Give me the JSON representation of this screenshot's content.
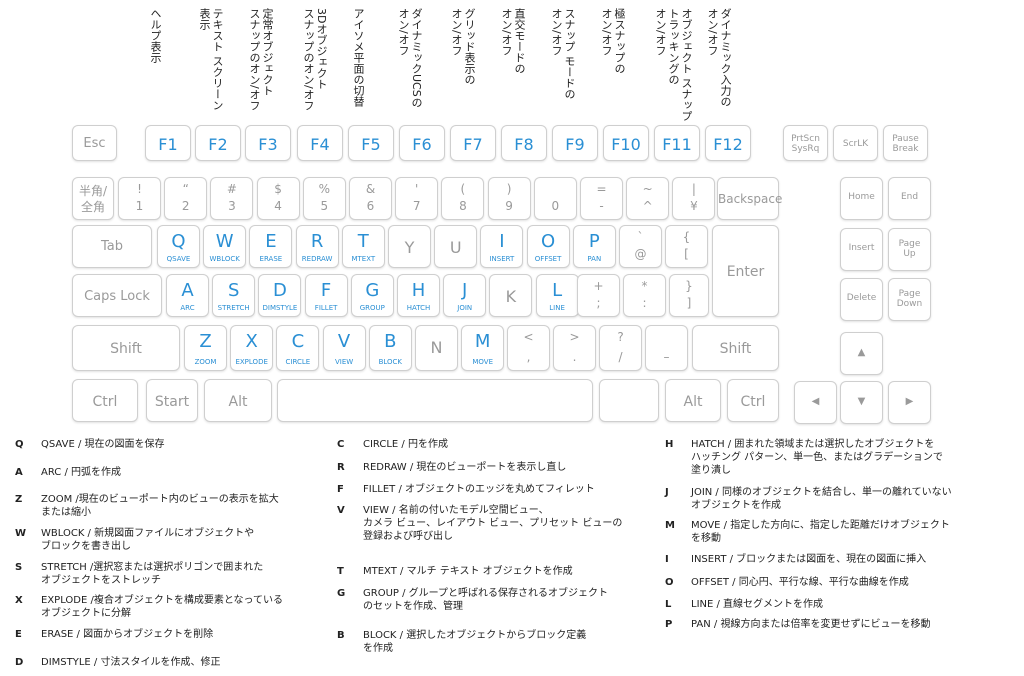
{
  "fkey_labels": {
    "f1": [
      "ヘルプ表示"
    ],
    "f2": [
      "テキスト スクリーン",
      "表示"
    ],
    "f3": [
      "定常オブジェクト",
      "スナップのオン/オフ"
    ],
    "f4": [
      "3Dオブジェクト",
      "スナップのオン/オフ"
    ],
    "f5": [
      "アイソメ平面の切替"
    ],
    "f6": [
      "ダイナミックUCSの",
      "オン/オフ"
    ],
    "f7": [
      "グリッド表示の",
      "オン/オフ"
    ],
    "f8": [
      "直交モードの",
      "オン/オフ"
    ],
    "f9": [
      "スナップ モードの",
      "オン/オフ"
    ],
    "f10": [
      "極スナップの",
      "オン/オフ"
    ],
    "f11": [
      "オブジェクト スナップ",
      "トラッキングの",
      "オン/オフ"
    ],
    "f12": [
      "ダイナミック入力の",
      "オン/オフ"
    ]
  },
  "keys": {
    "esc": "Esc",
    "f1": "F1",
    "f2": "F2",
    "f3": "F3",
    "f4": "F4",
    "f5": "F5",
    "f6": "F6",
    "f7": "F7",
    "f8": "F8",
    "f9": "F9",
    "f10": "F10",
    "f11": "F11",
    "f12": "F12",
    "prtscn": [
      "PrtScn",
      "SysRq"
    ],
    "scrlk": "ScrLK",
    "pause": [
      "Pause",
      "Break"
    ],
    "hankaku": [
      "半角/",
      "全角"
    ],
    "num_row": [
      {
        "top": "!",
        "bottom": "1"
      },
      {
        "top": "“",
        "bottom": "2"
      },
      {
        "top": "#",
        "bottom": "3"
      },
      {
        "top": "$",
        "bottom": "4"
      },
      {
        "top": "%",
        "bottom": "5"
      },
      {
        "top": "&",
        "bottom": "6"
      },
      {
        "top": "'",
        "bottom": "7"
      },
      {
        "top": "(",
        "bottom": "8"
      },
      {
        "top": ")",
        "bottom": "9"
      },
      {
        "top": "",
        "bottom": "0"
      },
      {
        "top": "=",
        "bottom": "-"
      },
      {
        "top": "~",
        "bottom": "^"
      },
      {
        "top": "|",
        "bottom": "¥"
      }
    ],
    "backspace": "Backspace",
    "tab": "Tab",
    "qrow": [
      {
        "l": "Q",
        "c": "QSAVE"
      },
      {
        "l": "W",
        "c": "WBLOCK"
      },
      {
        "l": "E",
        "c": "ERASE"
      },
      {
        "l": "R",
        "c": "REDRAW"
      },
      {
        "l": "T",
        "c": "MTEXT"
      },
      {
        "l": "Y",
        "c": ""
      },
      {
        "l": "U",
        "c": ""
      },
      {
        "l": "I",
        "c": "INSERT"
      },
      {
        "l": "O",
        "c": "OFFSET"
      },
      {
        "l": "P",
        "c": "PAN"
      }
    ],
    "at": {
      "top": "`",
      "bottom": "@"
    },
    "lbracket": {
      "top": "{",
      "bottom": "["
    },
    "enter": "Enter",
    "capslock": "Caps Lock",
    "arow": [
      {
        "l": "A",
        "c": "ARC"
      },
      {
        "l": "S",
        "c": "STRETCH"
      },
      {
        "l": "D",
        "c": "DIMSTYLE"
      },
      {
        "l": "F",
        "c": "FILLET"
      },
      {
        "l": "G",
        "c": "GROUP"
      },
      {
        "l": "H",
        "c": "HATCH"
      },
      {
        "l": "J",
        "c": "JOIN"
      },
      {
        "l": "K",
        "c": ""
      },
      {
        "l": "L",
        "c": "LINE"
      }
    ],
    "semicolon": {
      "top": "+",
      "bottom": ";"
    },
    "colon": {
      "top": "*",
      "bottom": ":"
    },
    "rbracket": {
      "top": "}",
      "bottom": "]"
    },
    "shift": "Shift",
    "zrow": [
      {
        "l": "Z",
        "c": "ZOOM"
      },
      {
        "l": "X",
        "c": "EXPLODE"
      },
      {
        "l": "C",
        "c": "CIRCLE"
      },
      {
        "l": "V",
        "c": "VIEW"
      },
      {
        "l": "B",
        "c": "BLOCK"
      },
      {
        "l": "N",
        "c": ""
      },
      {
        "l": "M",
        "c": "MOVE"
      }
    ],
    "comma": {
      "top": "<",
      "bottom": ","
    },
    "period": {
      "top": ">",
      "bottom": "."
    },
    "slash": {
      "top": "?",
      "bottom": "/"
    },
    "underscore": {
      "top": "",
      "bottom": "–"
    },
    "ctrl": "Ctrl",
    "start": "Start",
    "alt": "Alt",
    "home": "Home",
    "end": "End",
    "insert": "Insert",
    "pageup": [
      "Page",
      "Up"
    ],
    "delete": "Delete",
    "pagedown": [
      "Page",
      "Down"
    ],
    "up": "▲",
    "left": "◀",
    "down": "▼",
    "right": "▶"
  },
  "descriptions": {
    "col1": [
      {
        "letter": "Q",
        "lines": [
          "QSAVE / 現在の図面を保存"
        ]
      },
      {
        "letter": "A",
        "lines": [
          "ARC / 円弧を作成"
        ]
      },
      {
        "letter": "Z",
        "lines": [
          "ZOOM /現在のビューポート内のビューの表示を拡大",
          "または縮小"
        ]
      },
      {
        "letter": "W",
        "lines": [
          "WBLOCK / 新規図面ファイルにオブジェクトや",
          "ブロックを書き出し"
        ]
      },
      {
        "letter": "S",
        "lines": [
          "STRETCH /選択窓または選択ポリゴンで囲まれた",
          "オブジェクトをストレッチ"
        ]
      },
      {
        "letter": "X",
        "lines": [
          "EXPLODE /複合オブジェクトを構成要素となっている",
          "オブジェクトに分解"
        ]
      },
      {
        "letter": "E",
        "lines": [
          "ERASE / 図面からオブジェクトを削除"
        ]
      },
      {
        "letter": "D",
        "lines": [
          "DIMSTYLE / 寸法スタイルを作成、修正"
        ]
      }
    ],
    "col2": [
      {
        "letter": "C",
        "lines": [
          "CIRCLE / 円を作成"
        ]
      },
      {
        "letter": "R",
        "lines": [
          "REDRAW / 現在のビューポートを表示し直し"
        ]
      },
      {
        "letter": "F",
        "lines": [
          "FILLET / オブジェクトのエッジを丸めてフィレット"
        ]
      },
      {
        "letter": "V",
        "lines": [
          "VIEW / 名前の付いたモデル空間ビュー、",
          "カメラ ビュー、レイアウト ビュー、プリセット ビューの",
          "登録および呼び出し"
        ]
      },
      {
        "letter": "T",
        "lines": [
          "MTEXT / マルチ テキスト オブジェクトを作成"
        ]
      },
      {
        "letter": "G",
        "lines": [
          "GROUP / グループと呼ばれる保存されるオブジェクト",
          "のセットを作成、管理"
        ]
      },
      {
        "letter": "B",
        "lines": [
          "BLOCK / 選択したオブジェクトからブロック定義",
          "を作成"
        ]
      }
    ],
    "col3": [
      {
        "letter": "H",
        "lines": [
          "HATCH / 囲まれた領域または選択したオブジェクトを",
          "ハッチング パターン、単一色、またはグラデーションで",
          "塗り潰し"
        ]
      },
      {
        "letter": "J",
        "lines": [
          "JOIN / 同様のオブジェクトを結合し、単一の離れていない",
          "オブジェクトを作成"
        ]
      },
      {
        "letter": "M",
        "lines": [
          "MOVE / 指定した方向に、指定した距離だけオブジェクト",
          "を移動"
        ]
      },
      {
        "letter": "I",
        "lines": [
          "INSERT / ブロックまたは図面を、現在の図面に挿入"
        ]
      },
      {
        "letter": "O",
        "lines": [
          "OFFSET / 同心円、平行な線、平行な曲線を作成"
        ]
      },
      {
        "letter": "L",
        "lines": [
          "LINE / 直線セグメントを作成"
        ]
      },
      {
        "letter": "P",
        "lines": [
          "PAN / 視線方向または倍率を変更せずにビューを移動"
        ]
      }
    ]
  }
}
